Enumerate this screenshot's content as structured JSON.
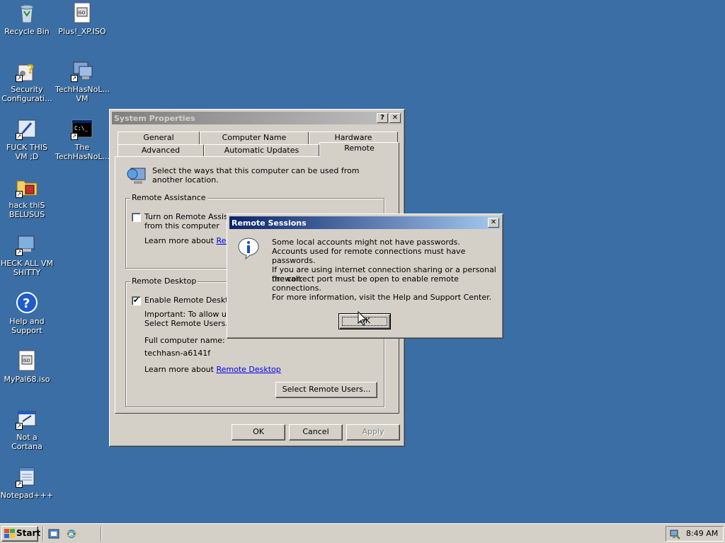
{
  "desktop": {
    "icons": [
      {
        "label": "Recycle Bin",
        "icon": "recycle-bin-icon"
      },
      {
        "label": "Plus!_XP.ISO",
        "icon": "iso-file-icon"
      },
      {
        "label": "Security Configurati...",
        "icon": "security-config-icon"
      },
      {
        "label": "TechHasNoL... VM",
        "icon": "computer-icon"
      },
      {
        "label": "FUCK THIS VM ;D",
        "icon": "shortcut-app-icon"
      },
      {
        "label": "The TechHasNoL...",
        "icon": "command-prompt-icon"
      },
      {
        "label": "hack thiS BELUSUS",
        "icon": "folder-icon"
      },
      {
        "label": "HECK ALL VM SHITTY",
        "icon": "computer-icon"
      },
      {
        "label": "Help and Support",
        "icon": "help-icon"
      },
      {
        "label": "MyPal68.iso",
        "icon": "iso-file-icon"
      },
      {
        "label": "Not a Cortana",
        "icon": "shortcut-app-icon"
      },
      {
        "label": "Notepad+++",
        "icon": "notepad-icon"
      }
    ]
  },
  "system_properties": {
    "title": "System Properties",
    "help_btn": "?",
    "close_btn": "✕",
    "tabs_row1": [
      "General",
      "Computer Name",
      "Hardware"
    ],
    "tabs_row2": [
      "Advanced",
      "Automatic Updates",
      "Remote"
    ],
    "selected_tab": "Remote",
    "intro": "Select the ways that this computer can be used from another location.",
    "remote_assistance": {
      "group_title": "Remote Assistance",
      "checkbox_label": "Turn on Remote Assistance and allow invitations to be sent from this computer",
      "checked": false,
      "learn_more_prefix": "Learn more about",
      "learn_more_link": "Remote"
    },
    "remote_desktop": {
      "group_title": "Remote Desktop",
      "checkbox_label": "Enable Remote Desktop",
      "checked": true,
      "important_line1": "Important: To allow users",
      "important_line2": "Select Remote Users.",
      "full_name_label": "Full computer name:",
      "full_name_value": "techhasn-a6141f",
      "learn_more_prefix": "Learn more about",
      "learn_more_link": "Remote Desktop",
      "select_users_btn": "Select Remote Users..."
    },
    "ok_btn": "OK",
    "cancel_btn": "Cancel",
    "apply_btn": "Apply"
  },
  "remote_sessions": {
    "title": "Remote Sessions",
    "close_btn": "✕",
    "line1": "Some local accounts might not have passwords.",
    "line2": "Accounts used for remote connections must have passwords.",
    "line3": "If you are using internet connection sharing or a personal firewall,",
    "line4": "the correct port must be open to enable remote connections.",
    "line5": "For more information, visit the Help and Support Center.",
    "ok_btn": "OK"
  },
  "taskbar": {
    "start_label": "Start",
    "clock": "8:49 AM"
  }
}
